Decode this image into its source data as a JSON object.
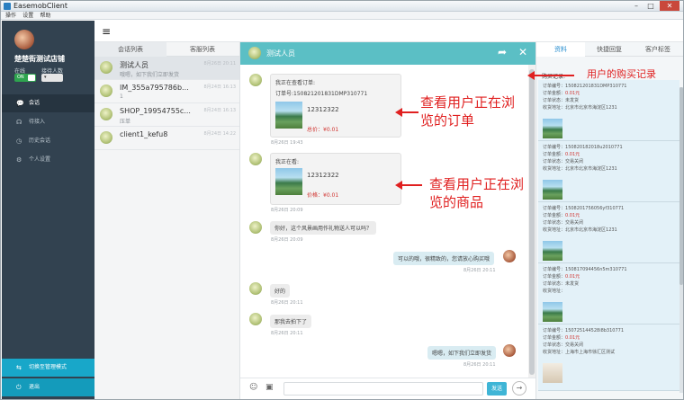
{
  "window": {
    "title": "EasemobClient"
  },
  "menu": [
    "操作",
    "设置",
    "帮助"
  ],
  "sidebar": {
    "shop_name": "楚楚街测试店铺",
    "status_label": "在线",
    "max_label": "接待人数",
    "toggle_on": "ON",
    "nav": [
      "会话",
      "待接入",
      "历史会话",
      "个人设置"
    ],
    "bottom": [
      "切换至管理模式",
      "退出"
    ]
  },
  "convlist": {
    "tabs": [
      "会话列表",
      "客服列表"
    ],
    "items": [
      {
        "name": "测试人员",
        "sub": "哦嗯，如下我们立即发货",
        "time": "8月26日 20:11"
      },
      {
        "name": "IM_355a795786b...",
        "sub": "1",
        "time": "8月24日 16:13"
      },
      {
        "name": "SHOP_19954755c...",
        "sub": "压单",
        "time": "8月24日 16:13"
      },
      {
        "name": "client1_kefu8",
        "sub": "",
        "time": "8月24日 14:22"
      }
    ]
  },
  "chat": {
    "title": "测试人员",
    "order_card": {
      "line1": "我正在查看订单:",
      "line2": "订单号:150821201831DMP310771",
      "item": "12312322",
      "total": "总价：¥0.01",
      "time": "8月26日 19:43"
    },
    "product_card": {
      "line1": "我正在看:",
      "item": "12312322",
      "price": "价格：¥0.01",
      "time": "8月26日 20:09"
    },
    "messages": [
      {
        "text": "你好，这个风景画用作礼物送人可以吗？",
        "time": "8月26日 20:09",
        "me": false
      },
      {
        "text": "可以的哦，很精致的，您请放心购买哦",
        "time": "8月26日 20:11",
        "me": true
      },
      {
        "text": "好的",
        "time": "8月26日 20:11",
        "me": false
      },
      {
        "text": "那我去拍下了",
        "time": "8月26日 20:11",
        "me": false
      },
      {
        "text": "嗯嗯，如下我们立即发货",
        "time": "8月26日 20:11",
        "me": true
      }
    ],
    "send": "发送"
  },
  "rpanel": {
    "tabs": [
      "资料",
      "快捷回复",
      "客户标签"
    ],
    "record_label": "购买记录:",
    "orders": [
      {
        "no": "150821201831DMP310771",
        "amount": "0.01元",
        "status": "未发货",
        "addr": "北京市北京市海淀区1231"
      },
      {
        "no": "150820182018u2010771",
        "amount": "0.01元",
        "status": "交易关闭",
        "addr": "北京市北京市海淀区1231"
      },
      {
        "no": "1508201756056yf310771",
        "amount": "0.01元",
        "status": "交易关闭",
        "addr": "北京市北京市海淀区1231"
      },
      {
        "no": "150817094456n5m310771",
        "amount": "0.01元",
        "status": "未发货",
        "addr": ""
      },
      {
        "no": "150725144528i8b310771",
        "amount": "0.01元",
        "status": "交易关闭",
        "addr": "上海市上海市徐汇区测试"
      }
    ],
    "labels": {
      "no": "订单编号：",
      "amount": "订单金额：",
      "status": "订单状态：",
      "addr": "收货地址："
    }
  },
  "annotations": {
    "record": "用户的购买记录",
    "order": "查看用户正在浏览的订单",
    "product": "查看用户正在浏览的商品"
  },
  "colors": {
    "sidebar": "#324250",
    "header": "#5bbfc5",
    "accent": "#18a7c9",
    "annotation": "#e02020"
  }
}
